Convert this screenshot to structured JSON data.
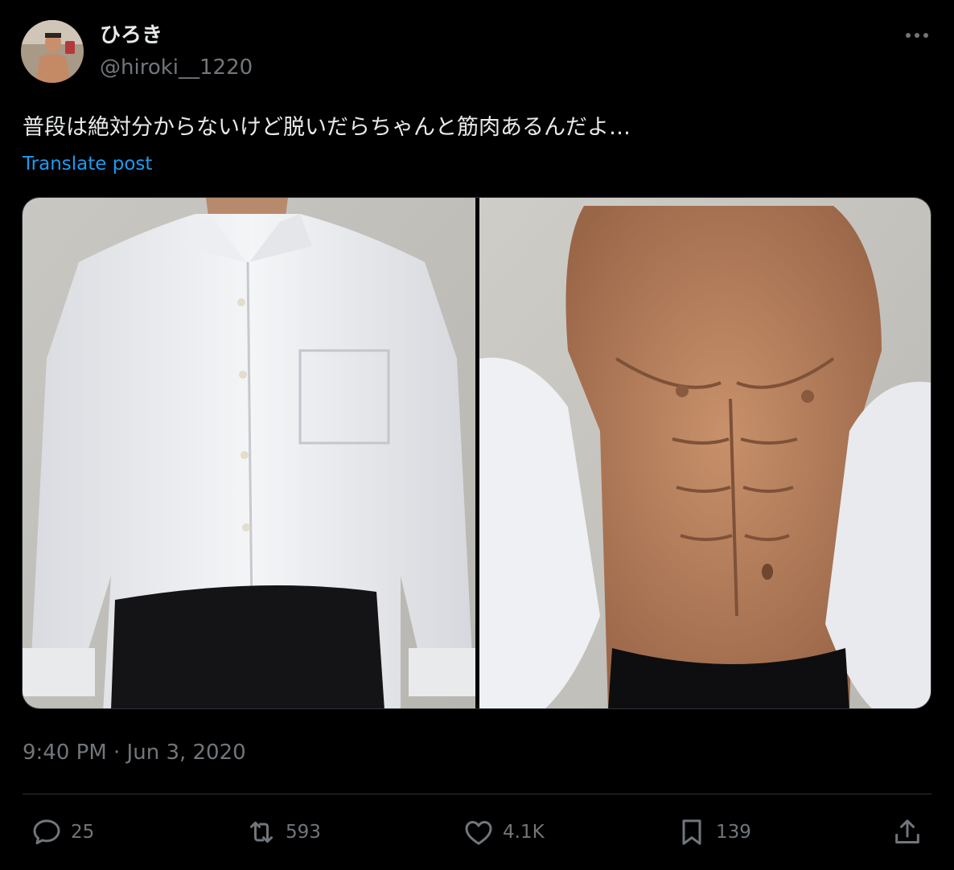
{
  "author": {
    "display_name": "ひろき",
    "handle": "@hiroki__1220"
  },
  "post": {
    "text": "普段は絶対分からないけど脱いだらちゃんと筋肉あるんだよ…",
    "translate_label": "Translate post",
    "timestamp": "9:40 PM · Jun 3, 2020"
  },
  "actions": {
    "replies": "25",
    "reposts": "593",
    "likes": "4.1K",
    "bookmarks": "139"
  },
  "icons": {
    "more": "more-horizontal-icon",
    "reply": "reply-icon",
    "repost": "repost-icon",
    "like": "heart-icon",
    "bookmark": "bookmark-icon",
    "share": "share-icon"
  },
  "colors": {
    "background": "#000000",
    "text_primary": "#e7e9ea",
    "text_secondary": "#71767b",
    "link": "#1d9bf0",
    "border": "#2f3336"
  }
}
